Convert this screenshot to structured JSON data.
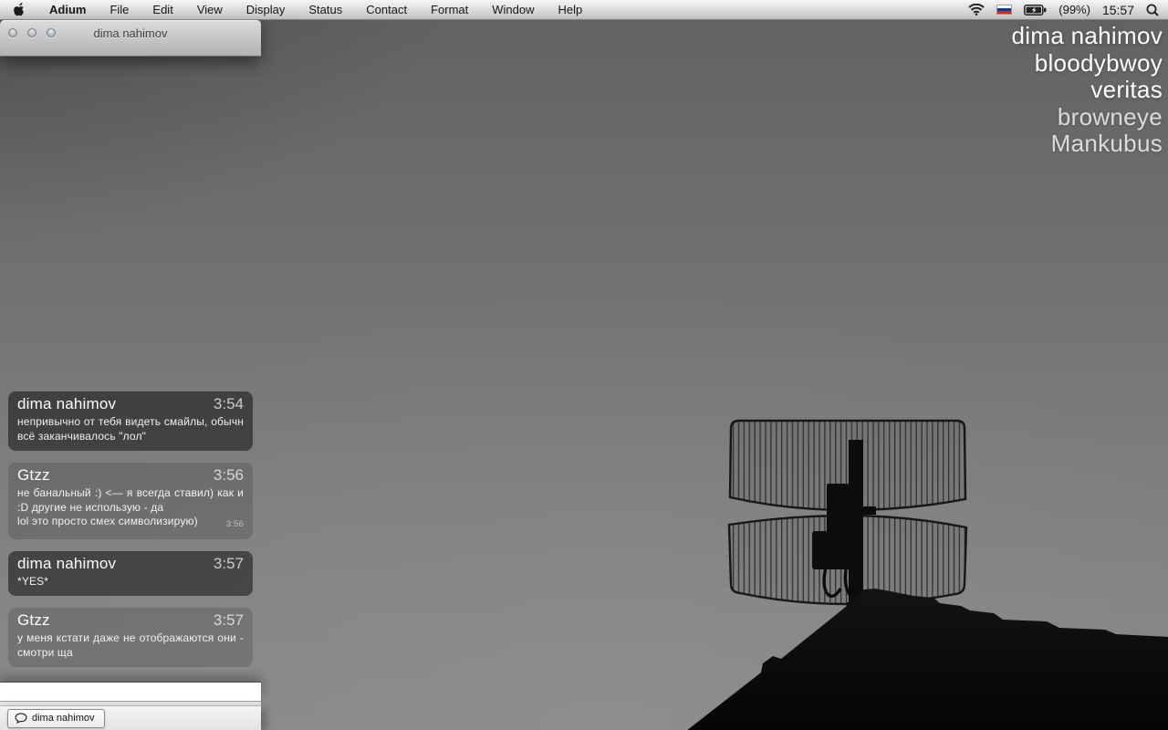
{
  "menu_bar": {
    "items": [
      {
        "label": "Adium",
        "app": true
      },
      {
        "label": "File"
      },
      {
        "label": "Edit"
      },
      {
        "label": "View"
      },
      {
        "label": "Display"
      },
      {
        "label": "Status"
      },
      {
        "label": "Contact"
      },
      {
        "label": "Format"
      },
      {
        "label": "Window"
      },
      {
        "label": "Help"
      }
    ],
    "status": {
      "wifi_icon": "wifi-icon",
      "flag_icon": "flag-russia-icon",
      "battery_icon": "battery-charging-icon",
      "battery_label": "(99%)",
      "clock": "15:57",
      "search_icon": "spotlight-search-icon"
    }
  },
  "chat_window": {
    "title": "dima nahimov",
    "messages": [
      {
        "sender": "dima nahimov",
        "time": "3:54",
        "variant": "dark",
        "lines": [
          {
            "text": "непривычно от тебя видеть смайлы, обычн всё заканчивалось \"лол\""
          }
        ]
      },
      {
        "sender": "Gtzz",
        "time": "3:56",
        "variant": "light",
        "lines": [
          {
            "text": "не банальный :)  <— я всегда ставил) как и :D другие не использую - да"
          },
          {
            "text": "lol это просто смех символизирую)",
            "time": "3:56"
          }
        ]
      },
      {
        "sender": "dima nahimov",
        "time": "3:57",
        "variant": "dark",
        "lines": [
          {
            "text": "*YES*"
          }
        ]
      },
      {
        "sender": "Gtzz",
        "time": "3:57",
        "variant": "light",
        "lines": [
          {
            "text": "у меня кстати даже не отображаются они - смотри ща"
          }
        ]
      }
    ],
    "input_value": "",
    "tab": {
      "icon": "chat-bubble-icon",
      "label": "dima nahimov"
    }
  },
  "contact_list": {
    "contacts": [
      {
        "name": "dima nahimov",
        "dimmed": false
      },
      {
        "name": "bloodybwoy",
        "dimmed": false
      },
      {
        "name": "veritas",
        "dimmed": false
      },
      {
        "name": "browneye",
        "dimmed": true
      },
      {
        "name": "Mankubus",
        "dimmed": true
      }
    ]
  },
  "colors": {
    "flag_stripes": [
      "#ffffff",
      "#0039a6",
      "#d52b1e"
    ],
    "desktop_mid_gray": "#7d7d7d",
    "bubble_dark": "rgba(12,12,12,0.52)",
    "bubble_light": "rgba(30,30,30,0.18)",
    "contact_text": "#ffffff"
  }
}
